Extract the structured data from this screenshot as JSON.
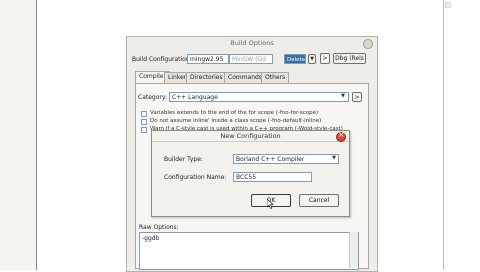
{
  "dialog": {
    "title": "Build Options",
    "build_config_label": "Build Configuration:",
    "build_config_value": "mingw2.95",
    "compiler_value": "MinGW (Gd",
    "delete_label": "Delete",
    "arrow_label": ">",
    "dbg_label": "Dbg (Rels",
    "tabs": [
      "Compiler",
      "Linker",
      "Directories",
      "Commands",
      "Others"
    ],
    "category_label": "Category:",
    "category_value": "C++ Language",
    "options": [
      "Variables extends to the end of the for scope (-fno-for-scope)",
      "Do not assume inline' inside a class scope (-fno-default-inline)",
      "Warn if a C-style cast is used within a C++ program (-Wold-style-cast)"
    ],
    "raw_options_label": "Raw Options:",
    "raw_options_value": "-ggdb"
  },
  "new_config": {
    "title": "New Configuration",
    "builder_type_label": "Builder Type:",
    "builder_type_value": "Borland C++ Compiler",
    "config_name_label": "Configuration Name:",
    "config_name_value": "BCC55",
    "ok_label": "OK",
    "cancel_label": "Cancel"
  },
  "colors": {
    "selection": "#3a6ea5",
    "close_red": "#d9483a"
  }
}
